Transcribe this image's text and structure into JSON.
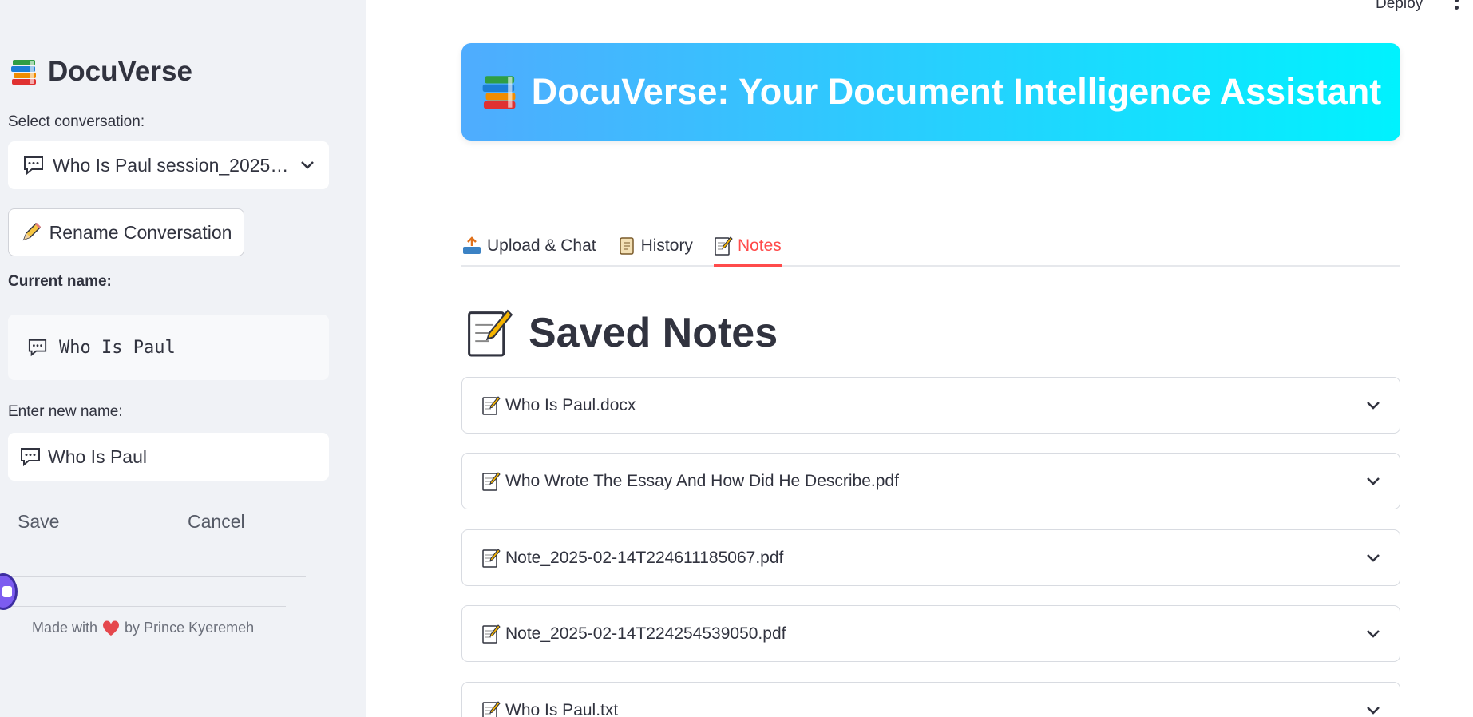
{
  "sidebar": {
    "title": "DocuVerse",
    "select_label": "Select conversation:",
    "selected_conversation": "Who Is Paul session_2025…",
    "rename_button": "Rename Conversation",
    "current_name_label": "Current name:",
    "current_name_value": "Who Is Paul",
    "new_name_label": "Enter new name:",
    "new_name_value": "Who Is Paul",
    "save_button": "Save",
    "cancel_button": "Cancel",
    "footer_prefix": "Made with",
    "footer_suffix": "by Prince Kyeremeh"
  },
  "header": {
    "deploy": "Deploy"
  },
  "hero": {
    "title": "DocuVerse: Your Document Intelligence Assistant"
  },
  "tabs": [
    {
      "label": "Upload & Chat",
      "icon": "inbox-tray-icon"
    },
    {
      "label": "History",
      "icon": "scroll-icon"
    },
    {
      "label": "Notes",
      "icon": "memo-icon",
      "active": true
    }
  ],
  "main": {
    "heading": "Saved Notes",
    "notes": [
      "Who Is Paul.docx",
      "Who Wrote The Essay And How Did He Describe.pdf",
      "Note_2025-02-14T224611185067.pdf",
      "Note_2025-02-14T224254539050.pdf",
      "Who Is Paul.txt"
    ]
  },
  "colors": {
    "accent": "#ff4b4b",
    "hero_gradient_start": "#4facfe",
    "hero_gradient_end": "#00f2fe",
    "sidebar_bg": "#f0f2f6"
  }
}
